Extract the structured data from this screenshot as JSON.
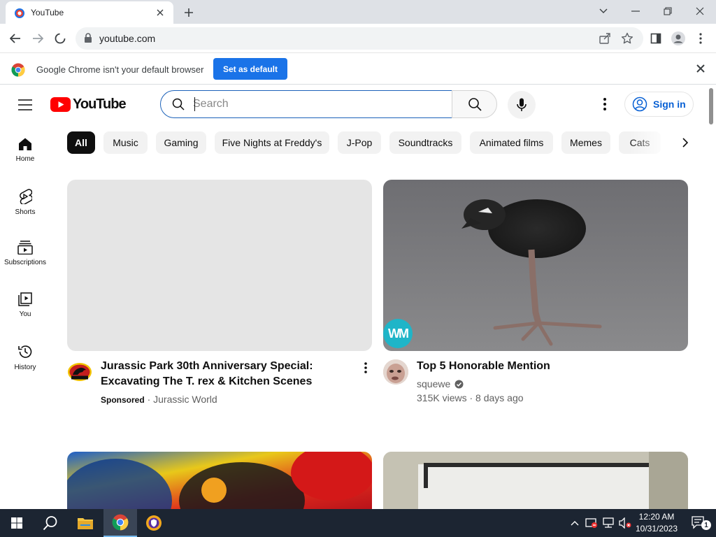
{
  "browser": {
    "tab_title": "YouTube",
    "url": "youtube.com",
    "infobar_message": "Google Chrome isn't your default browser",
    "infobar_button": "Set as default"
  },
  "youtube": {
    "logo_text": "YouTube",
    "search_placeholder": "Search",
    "sign_in_label": "Sign in",
    "guide": [
      {
        "label": "Home",
        "icon": "home-icon"
      },
      {
        "label": "Shorts",
        "icon": "shorts-icon"
      },
      {
        "label": "Subscriptions",
        "icon": "subscriptions-icon"
      },
      {
        "label": "You",
        "icon": "you-icon"
      },
      {
        "label": "History",
        "icon": "history-icon"
      }
    ],
    "chips": [
      "All",
      "Music",
      "Gaming",
      "Five Nights at Freddy's",
      "J-Pop",
      "Soundtracks",
      "Animated films",
      "Memes",
      "Cats"
    ],
    "videos": [
      {
        "title_line1": "Jurassic Park 30th Anniversary Special:",
        "title_line2": "Excavating The T. rex & Kitchen Scenes",
        "sponsored": "Sponsored",
        "channel": "Jurassic World"
      },
      {
        "title_line1": "Top 5 Honorable Mention",
        "channel": "squewe",
        "views": "315K views",
        "age": "8 days ago",
        "badge": "WM"
      }
    ]
  },
  "taskbar": {
    "time": "12:20 AM",
    "date": "10/31/2023",
    "notifications": "1"
  },
  "colors": {
    "youtube_red": "#ff0000",
    "chrome_blue": "#1a73e8",
    "signin_blue": "#065fd4",
    "taskbar": "#1c2532"
  }
}
